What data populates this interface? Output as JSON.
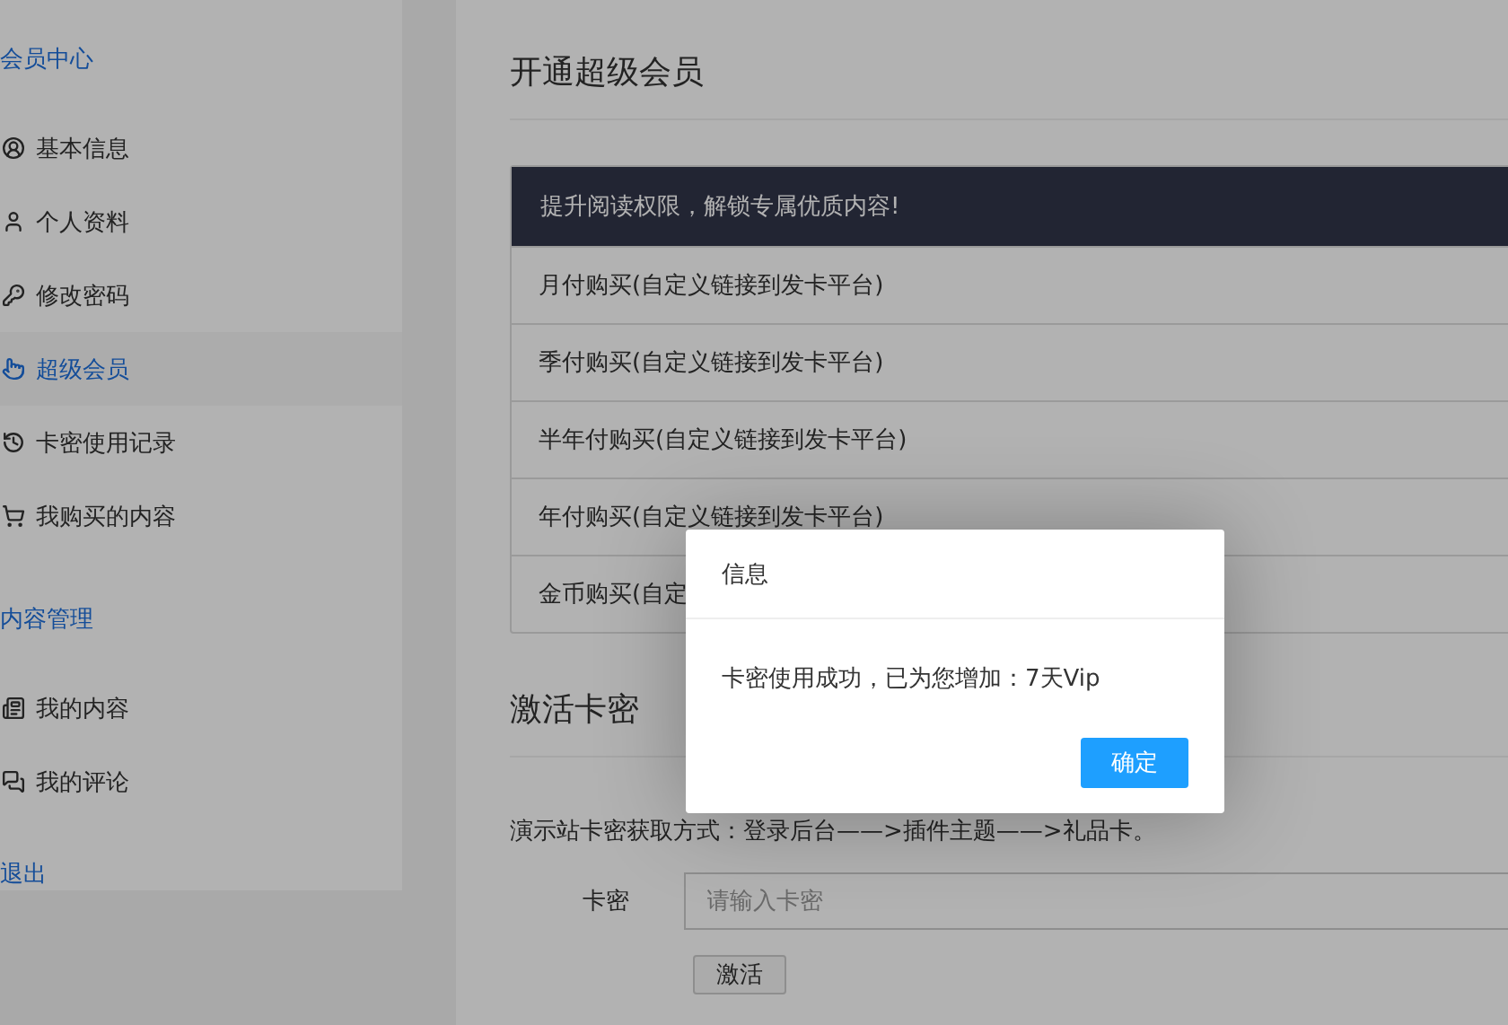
{
  "sidebar": {
    "sections": [
      {
        "heading": "会员中心",
        "items": [
          {
            "label": "基本信息",
            "selected": false
          },
          {
            "label": "个人资料",
            "selected": false
          },
          {
            "label": "修改密码",
            "selected": false
          },
          {
            "label": "超级会员",
            "selected": true
          },
          {
            "label": "卡密使用记录",
            "selected": false
          },
          {
            "label": "我购买的内容",
            "selected": false
          }
        ]
      },
      {
        "heading": "内容管理",
        "items": [
          {
            "label": "我的内容",
            "selected": false
          },
          {
            "label": "我的评论",
            "selected": false
          }
        ]
      }
    ],
    "logout": "退出"
  },
  "vip": {
    "title": "开通超级会员",
    "panel_header": "提升阅读权限，解锁专属优质内容!",
    "options": [
      "月付购买(自定义链接到发卡平台)",
      "季付购买(自定义链接到发卡平台)",
      "半年付购买(自定义链接到发卡平台)",
      "年付购买(自定义链接到发卡平台)",
      "金币购买(自定"
    ]
  },
  "activate": {
    "title": "激活卡密",
    "hint": "演示站卡密获取方式：登录后台——>插件主题——>礼品卡。",
    "field_label": "卡密",
    "placeholder": "请输入卡密",
    "button": "激活"
  },
  "dialog": {
    "title": "信息",
    "message": "卡密使用成功，已为您增加：7天Vip",
    "button": "确定"
  }
}
